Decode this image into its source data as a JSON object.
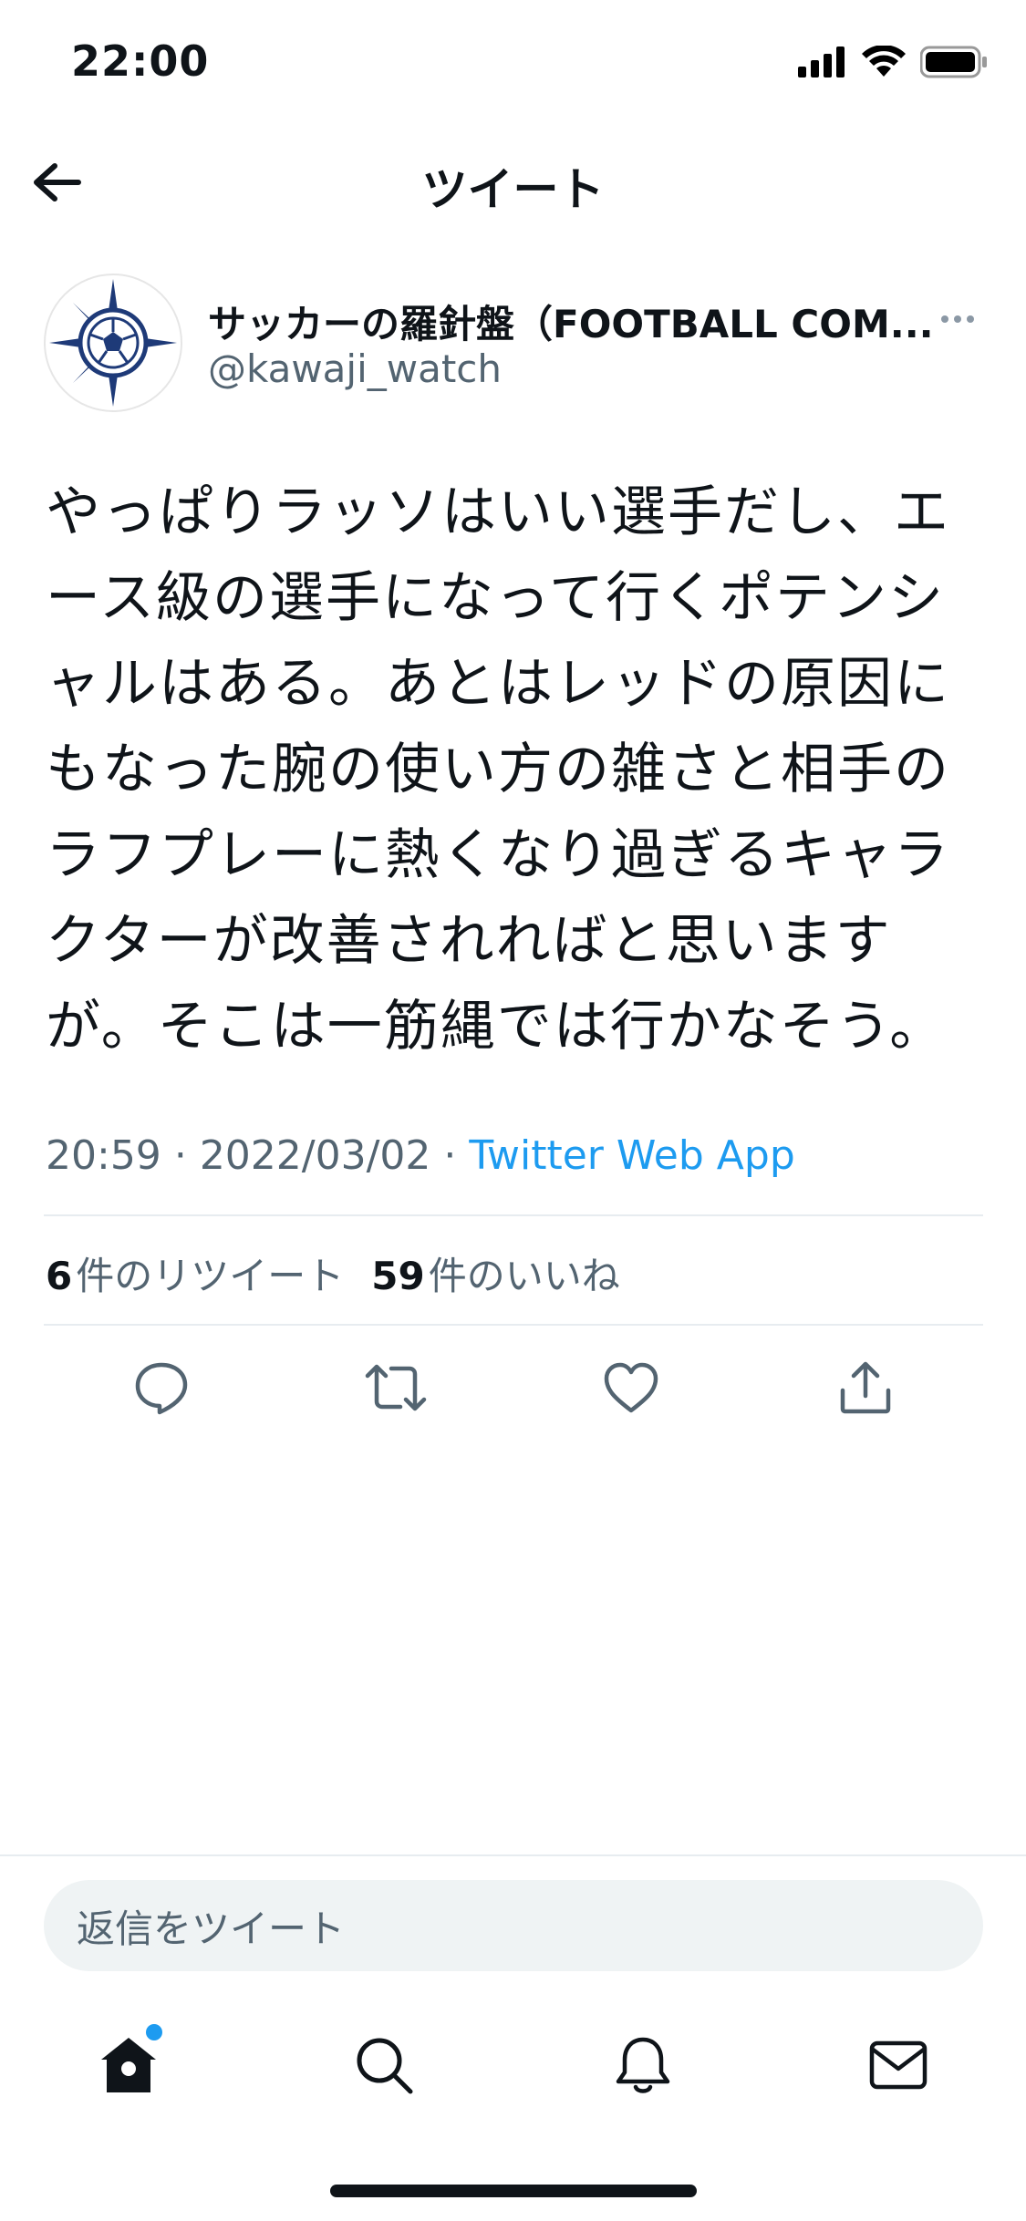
{
  "status_bar": {
    "time": "22:00"
  },
  "header": {
    "title": "ツイート"
  },
  "tweet": {
    "author_name": "サッカーの羅針盤（FOOTBALL COM...",
    "author_handle": "@kawaji_watch",
    "text": "やっぱりラッソはいい選手だし、エース級の選手になって行くポテンシャルはある。あとはレッドの原因にもなった腕の使い方の雑さと相手のラフプレーに熱くなり過ぎるキャラクターが改善されればと思いますが。そこは一筋縄では行かなそう。",
    "time": "20:59",
    "separator": "·",
    "date": "2022/03/02",
    "source": "Twitter Web App",
    "retweet_count": "6",
    "retweet_label": "件のリツイート",
    "like_count": "59",
    "like_label": "件のいいね"
  },
  "reply": {
    "placeholder": "返信をツイート"
  },
  "tabs": [
    "home-icon",
    "search-icon",
    "bell-icon",
    "mail-icon"
  ],
  "colors": {
    "accent": "#1d9bf0",
    "text": "#0f1419",
    "secondary": "#536471",
    "avatar_navy": "#1e3a78"
  }
}
